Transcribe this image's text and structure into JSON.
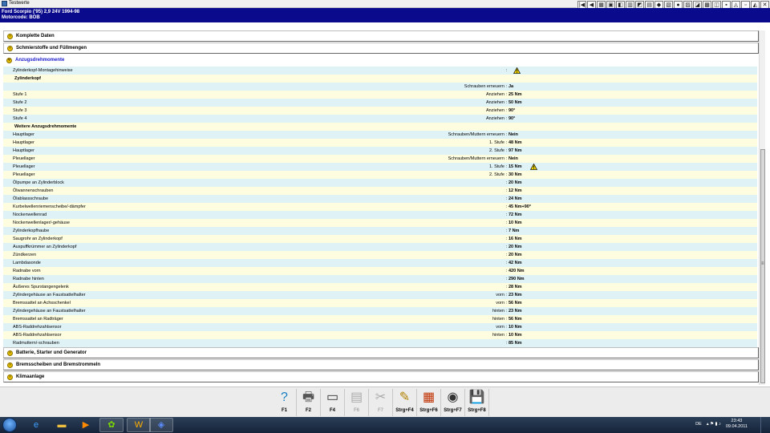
{
  "window": {
    "title": "Testwerte"
  },
  "header": {
    "line1": "Ford   Scorpio ('95) 2,9 24V 1994-98",
    "line2": "Motorcode: BOB"
  },
  "toolbar_icons": [
    "first-page-icon",
    "previous-page-icon",
    "tool-icon-1",
    "tool-icon-2",
    "tool-icon-3",
    "tool-icon-4",
    "tool-icon-5",
    "tool-icon-6",
    "tool-icon-7",
    "tool-icon-8",
    "tool-icon-9",
    "tool-icon-10",
    "tool-icon-11",
    "tool-icon-12",
    "tool-icon-13",
    "tool-icon-14",
    "tool-icon-15",
    "tool-icon-16",
    "tool-icon-17",
    "tool-icon-18"
  ],
  "sections_top": [
    {
      "label": "Komplette Daten"
    },
    {
      "label": "Schmierstoffe und Füllmengen"
    }
  ],
  "open_section": {
    "label": "Anzugsdrehmomente"
  },
  "rows": [
    {
      "name": "Zylinderkopf-Montagehinweise",
      "param": ":",
      "value": "",
      "warn": "near"
    },
    {
      "name": "Zylinderkopf",
      "param": "",
      "value": "",
      "sub": true
    },
    {
      "name": "",
      "param": "Schrauben erneuern :",
      "value": "Ja"
    },
    {
      "name": "Stufe 1",
      "param": "Anziehen :",
      "value": "25 Nm"
    },
    {
      "name": "Stufe 2",
      "param": "Anziehen :",
      "value": "50 Nm"
    },
    {
      "name": "Stufe 3",
      "param": "Anziehen :",
      "value": "90°"
    },
    {
      "name": "Stufe 4",
      "param": "Anziehen :",
      "value": "90°"
    },
    {
      "name": "Weitere Anzugsdrehmomente",
      "param": "",
      "value": "",
      "sub": true
    },
    {
      "name": "Hauptlager",
      "param": "Schrauben/Muttern erneuern :",
      "value": "Nein"
    },
    {
      "name": "Hauptlager",
      "param": "1. Stufe :",
      "value": "48 Nm"
    },
    {
      "name": "Hauptlager",
      "param": "2. Stufe :",
      "value": "97 Nm"
    },
    {
      "name": "Pleuellager",
      "param": "Schrauben/Muttern erneuern :",
      "value": "Nein"
    },
    {
      "name": "Pleuellager",
      "param": "1. Stufe :",
      "value": "15 Nm",
      "warn": "far"
    },
    {
      "name": "Pleuellager",
      "param": "2. Stufe :",
      "value": "30 Nm"
    },
    {
      "name": "Ölpumpe an Zylinderblock",
      "param": ":",
      "value": "20 Nm"
    },
    {
      "name": "Ölwannenschrauben",
      "param": ":",
      "value": "12 Nm"
    },
    {
      "name": "Ölablassschraube",
      "param": ":",
      "value": "24 Nm"
    },
    {
      "name": "Kurbelwellenriemenscheibe/-dämpfer",
      "param": ":",
      "value": "45 Nm+90°"
    },
    {
      "name": "Nockenwellenrad",
      "param": ":",
      "value": "72 Nm"
    },
    {
      "name": "Nockenwellenlager/-gehäuse",
      "param": ":",
      "value": "10 Nm"
    },
    {
      "name": "Zylinderkopfhaube",
      "param": ":",
      "value": "7 Nm"
    },
    {
      "name": "Saugrohr an Zylinderkopf",
      "param": ":",
      "value": "16 Nm"
    },
    {
      "name": "Auspuffkrümmer an Zylinderkopf",
      "param": ":",
      "value": "20 Nm"
    },
    {
      "name": "Zündkerzen",
      "param": ":",
      "value": "20 Nm"
    },
    {
      "name": "Lambdasonde",
      "param": ":",
      "value": "42 Nm"
    },
    {
      "name": "Radnabe vorn",
      "param": ":",
      "value": "420 Nm"
    },
    {
      "name": "Radnabe hinten",
      "param": ":",
      "value": "290 Nm"
    },
    {
      "name": "Äußeres Spurstangengelenk",
      "param": ":",
      "value": "28 Nm"
    },
    {
      "name": "Zylindergehäuse an Faustsattelhalter",
      "param": "vorn :",
      "value": "23 Nm"
    },
    {
      "name": "Bremssattel an Achsschenkel",
      "param": "vorn :",
      "value": "56 Nm"
    },
    {
      "name": "Zylindergehäuse an Faustsattelhalter",
      "param": "hinten :",
      "value": "23 Nm"
    },
    {
      "name": "Bremssattel an Radträger",
      "param": "hinten :",
      "value": "56 Nm"
    },
    {
      "name": "ABS-Raddrehzahlsensor",
      "param": "vorn :",
      "value": "10 Nm"
    },
    {
      "name": "ABS-Raddrehzahlsensor",
      "param": "hinten :",
      "value": "10 Nm"
    },
    {
      "name": "Radmuttern/-schrauben",
      "param": ":",
      "value": "85 Nm"
    }
  ],
  "sections_bottom": [
    {
      "label": "Batterie, Starter und Generator"
    },
    {
      "label": "Bremsscheiben und Bremstrommeln"
    },
    {
      "label": "Klimaanlage"
    }
  ],
  "fkeys": [
    {
      "label": "F1",
      "icon": "help-icon",
      "glyph": "?",
      "enabled": true,
      "color": "#1a7fc0"
    },
    {
      "label": "F2",
      "icon": "print-icon",
      "glyph": "🖶",
      "enabled": true,
      "color": "#555555"
    },
    {
      "label": "F4",
      "icon": "window-icon",
      "glyph": "▭",
      "enabled": true,
      "color": "#333333"
    },
    {
      "label": "F6",
      "icon": "data-icon",
      "glyph": "▤",
      "enabled": false,
      "color": "#aaaaaa"
    },
    {
      "label": "F7",
      "icon": "tools-icon",
      "glyph": "✂",
      "enabled": false,
      "color": "#aaaaaa"
    },
    {
      "label": "Strg+F4",
      "icon": "notes-icon",
      "glyph": "✎",
      "enabled": true,
      "color": "#b08000"
    },
    {
      "label": "Strg+F6",
      "icon": "calc-icon",
      "glyph": "▦",
      "enabled": true,
      "color": "#c03000"
    },
    {
      "label": "Strg+F7",
      "icon": "disc-icon",
      "glyph": "◉",
      "enabled": true,
      "color": "#333333"
    },
    {
      "label": "Strg+F8",
      "icon": "save-icon",
      "glyph": "💾",
      "enabled": true,
      "color": "#c00000"
    }
  ],
  "taskbar": {
    "apps": [
      {
        "icon": "ie-icon",
        "glyph": "e",
        "color": "#3fa0ff"
      },
      {
        "icon": "folder-icon",
        "glyph": "▬",
        "color": "#f0c040"
      },
      {
        "icon": "media-player-icon",
        "glyph": "▶",
        "color": "#ff8a00"
      },
      {
        "icon": "icq-icon",
        "glyph": "✿",
        "color": "#7cd900"
      },
      {
        "icon": "winamp-icon",
        "glyph": "W",
        "color": "#ffb000"
      },
      {
        "icon": "app-icon",
        "glyph": "◈",
        "color": "#5a8cff"
      }
    ],
    "lang": "DE",
    "time": "23:43",
    "date": "09.04.2011"
  }
}
